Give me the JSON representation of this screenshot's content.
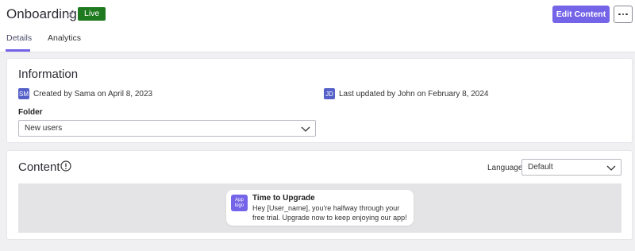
{
  "header": {
    "title": "Onboarding",
    "status_badge": "Live",
    "edit_button": "Edit Content",
    "more_button": "more-options"
  },
  "tabs": [
    {
      "label": "Details",
      "active": true
    },
    {
      "label": "Analytics",
      "active": false
    }
  ],
  "information": {
    "title": "Information",
    "created": {
      "avatar": "SM",
      "text": "Created by Sama on April 8, 2023"
    },
    "updated": {
      "avatar": "JD",
      "text": "Last updated by John on February 8, 2024"
    },
    "folder_label": "Folder",
    "folder_value": "New users"
  },
  "content": {
    "title": "Content",
    "language_label": "Language",
    "language_value": "Default",
    "preview": {
      "logo_text": "App logo",
      "title": "Time to Upgrade",
      "body": "Hey [User_name], you're halfway through your free trial. Upgrade now to keep enjoying our app!"
    }
  },
  "colors": {
    "accent": "#7464e8",
    "live_badge": "#1f7a1f",
    "avatar": "#5560c8"
  }
}
